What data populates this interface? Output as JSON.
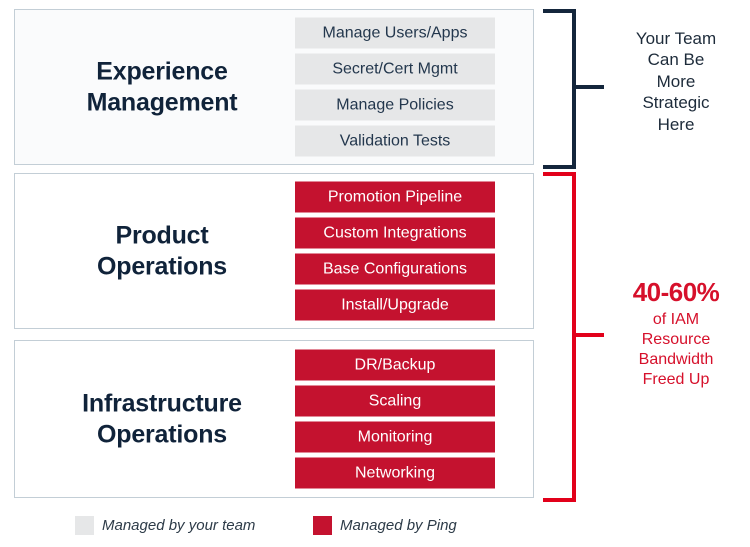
{
  "diagram": {
    "colors": {
      "red": "#c4122f",
      "brace_red": "#e2001a",
      "dark": "#14263c",
      "gray_pill": "#e6e7e8",
      "box_border": "#c3ced6"
    },
    "sections": [
      {
        "title_line1": "Experience",
        "title_line2": "Management",
        "owner": "team",
        "items": [
          "Manage Users/Apps",
          "Secret/Cert Mgmt",
          "Manage Policies",
          "Validation Tests"
        ]
      },
      {
        "title_line1": "Product",
        "title_line2": "Operations",
        "owner": "ping",
        "items": [
          "Promotion Pipeline",
          "Custom Integrations",
          "Base Configurations",
          "Install/Upgrade"
        ]
      },
      {
        "title_line1": "Infrastructure",
        "title_line2": "Operations",
        "owner": "ping",
        "items": [
          "DR/Backup",
          "Scaling",
          "Monitoring",
          "Networking"
        ]
      }
    ],
    "callouts": {
      "top": {
        "line1": "Your Team",
        "line2": "Can Be",
        "line3": "More",
        "line4": "Strategic",
        "line5": "Here"
      },
      "bottom": {
        "headline": "40-60%",
        "line1": "of IAM",
        "line2": "Resource",
        "line3": "Bandwidth",
        "line4": "Freed Up"
      }
    },
    "legend": [
      {
        "swatch": "gray",
        "label": "Managed by your team"
      },
      {
        "swatch": "red",
        "label": "Managed by Ping"
      }
    ]
  }
}
